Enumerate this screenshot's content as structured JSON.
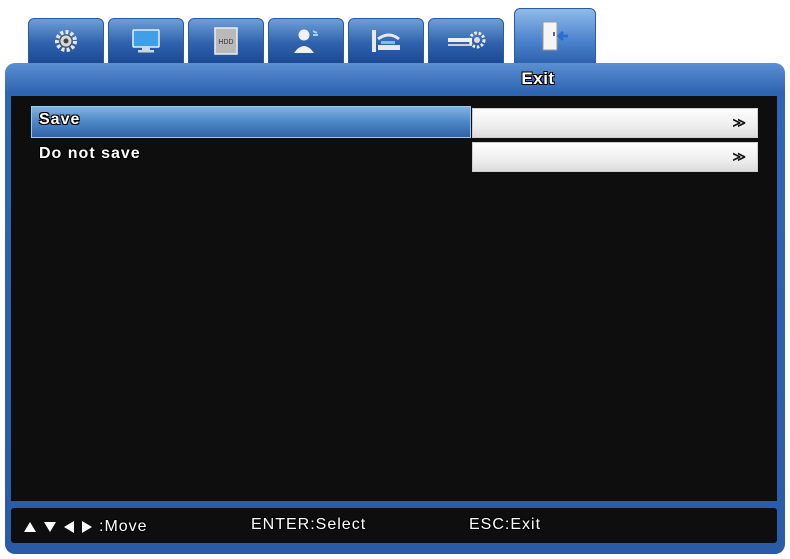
{
  "tabs": [
    {
      "icon": "gear-icon"
    },
    {
      "icon": "monitor-icon"
    },
    {
      "icon": "hdd-icon",
      "label": "HDD"
    },
    {
      "icon": "user-icon"
    },
    {
      "icon": "network-icon"
    },
    {
      "icon": "settings-slider-icon"
    },
    {
      "icon": "exit-door-icon",
      "active": true
    }
  ],
  "panel": {
    "title": "Exit"
  },
  "menu": {
    "items": [
      {
        "label": "Save",
        "value_icon": "≫",
        "selected": true
      },
      {
        "label": "Do not save",
        "value_icon": "≫",
        "selected": false
      }
    ]
  },
  "footer": {
    "move": ":Move",
    "select": "ENTER:Select",
    "exit": "ESC:Exit"
  },
  "colors": {
    "panel": "#2f66b3",
    "highlight": "#4d86c6",
    "background": "#0e0e0e"
  }
}
